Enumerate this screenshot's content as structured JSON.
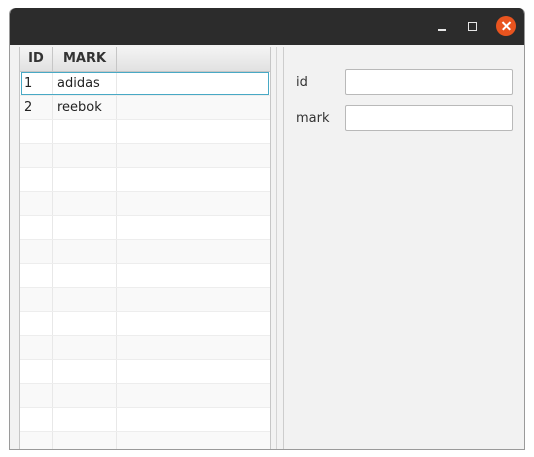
{
  "window": {
    "controls": {
      "minimize": "minimize-icon",
      "maximize": "maximize-icon",
      "close": "close-icon"
    },
    "close_color": "#e9541f"
  },
  "table": {
    "columns": [
      "ID",
      "MARK"
    ],
    "rows": [
      {
        "id": "1",
        "mark": "adidas"
      },
      {
        "id": "2",
        "mark": "reebok"
      }
    ],
    "empty_rows": 14,
    "selected_row_index": 0,
    "selection_color": "#48a9c5"
  },
  "form": {
    "fields": [
      {
        "label": "id",
        "value": ""
      },
      {
        "label": "mark",
        "value": ""
      }
    ]
  }
}
